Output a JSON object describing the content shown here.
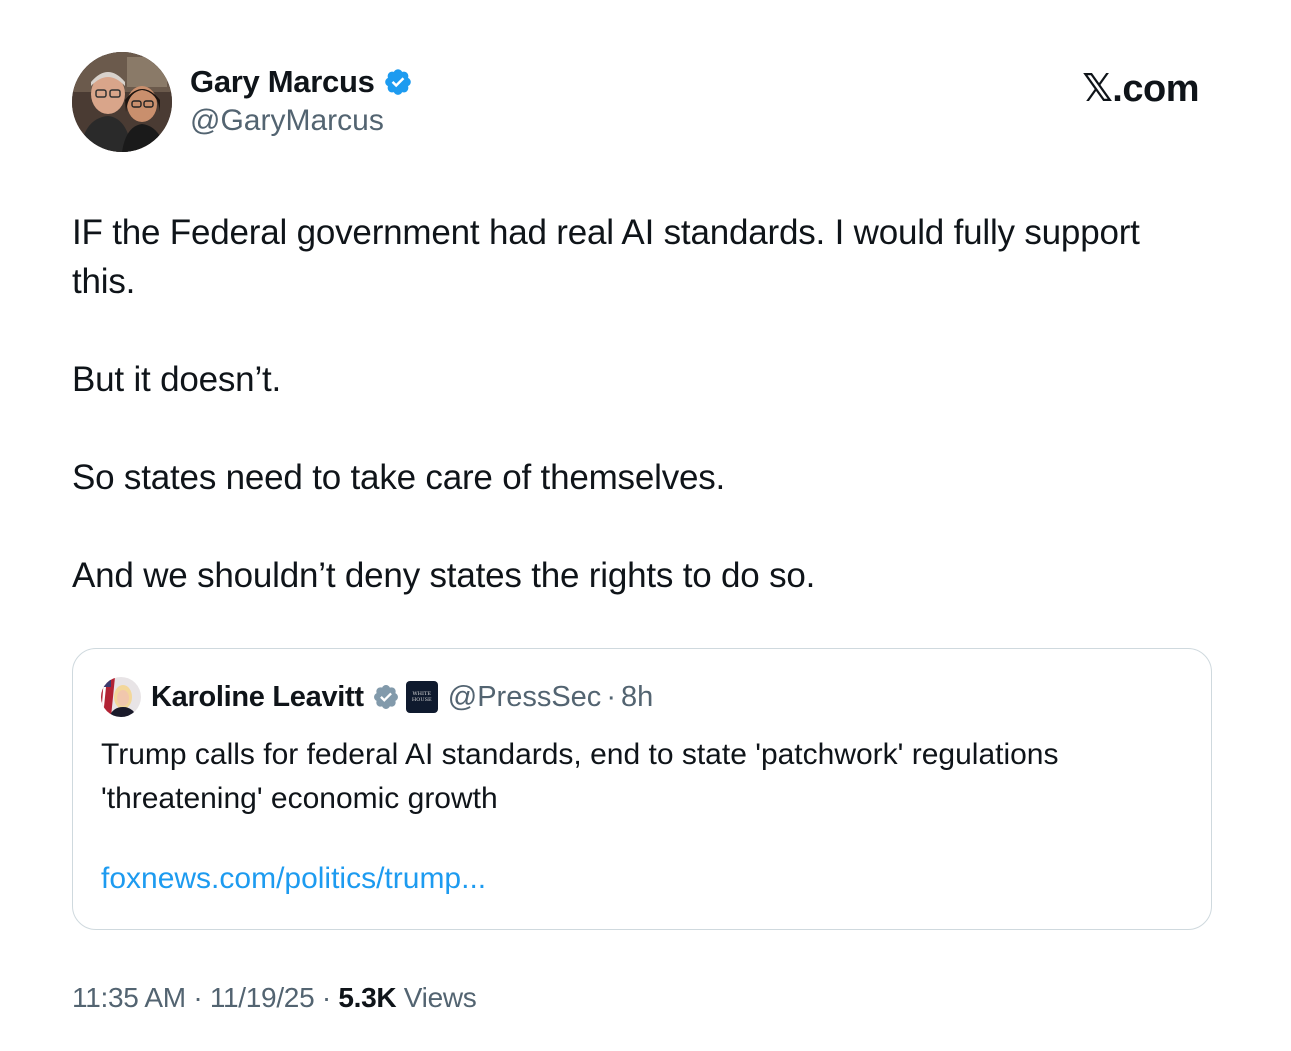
{
  "author": {
    "name": "Gary Marcus",
    "handle": "@GaryMarcus",
    "verified_icon": "verified-badge-blue"
  },
  "site": {
    "logo_text": "𝕏.com"
  },
  "tweet": {
    "paragraphs": [
      "IF the Federal government had real AI standards. I would fully support this.",
      "But it doesn’t.",
      "So states need to take care of themselves.",
      "And we shouldn’t deny states the rights to do so."
    ]
  },
  "quote": {
    "name": "Karoline Leavitt",
    "verified_icon": "verified-badge-gray",
    "affiliate_icon": "white-house-badge",
    "handle": "@PressSec",
    "separator": "·",
    "time": "8h",
    "text": "Trump calls for federal AI standards, end to state 'patchwork' regulations 'threatening' economic growth",
    "link": "foxnews.com/politics/trump..."
  },
  "meta": {
    "time": "11:35 AM",
    "sep1": "·",
    "date": "11/19/25",
    "sep2": "·",
    "views_count": "5.3K",
    "views_label": "Views"
  },
  "colors": {
    "text": "#0f1419",
    "secondary": "#536471",
    "link": "#1d9bf0",
    "verified_blue": "#1d9bf0",
    "border": "#cfd9de"
  }
}
